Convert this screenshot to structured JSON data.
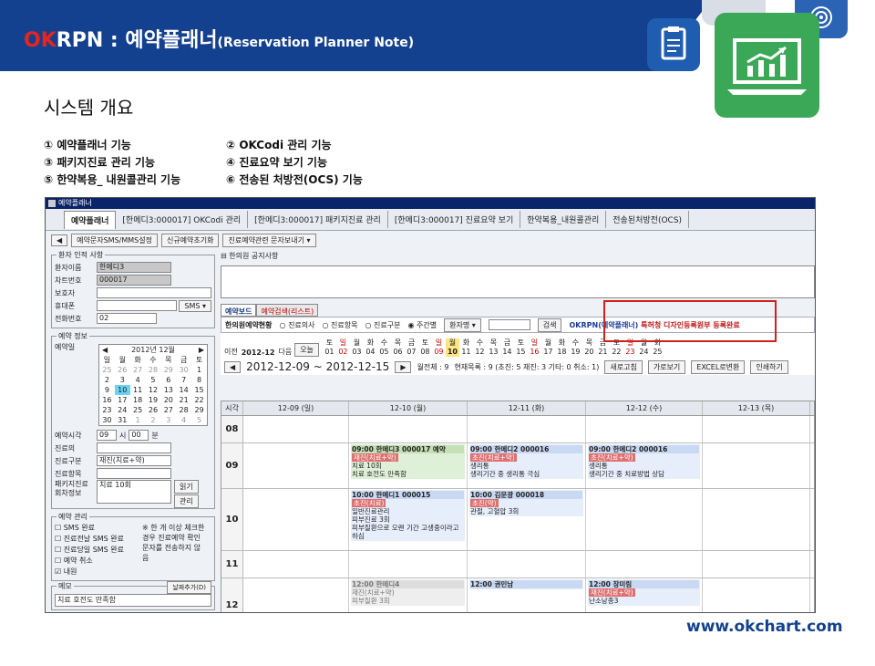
{
  "banner": {
    "title_ok": "OK",
    "title_rest": "RPN : 예약플래너",
    "title_sub": "(Reservation Planner Note)",
    "accent": "#e8241c",
    "brand": "#14418f"
  },
  "section_title": "시스템 개요",
  "features": [
    [
      "① 예약플래너 기능",
      "② OKCodi 관리 기능"
    ],
    [
      "③ 패키지진료 관리 기능",
      "④ 진료요약 보기 기능"
    ],
    [
      "⑤ 한약복용_ 내원콜관리 기능",
      "⑥ 전송된 처방전(OCS) 기능"
    ]
  ],
  "app": {
    "window_title": "예약플래너",
    "tabs": [
      "예약플래너",
      "[한메디3:000017] OKCodi 관리",
      "[한메디3:000017] 패키지진료 관리",
      "[한메디3:000017] 진료요약 보기",
      "한약복용_내원콜관리",
      "전송된처방전(OCS)"
    ],
    "toolbar": [
      "예약문자SMS/MMS설정",
      "신규예약초기화",
      "진료예약관련 문자보내기 ▾"
    ],
    "patient": {
      "legend": "환자 인적 사항",
      "fields": [
        {
          "label": "환자이름",
          "value": "한메디3"
        },
        {
          "label": "차트번호",
          "value": "000017"
        },
        {
          "label": "보호자",
          "value": ""
        },
        {
          "label": "휴대폰",
          "value": ""
        },
        {
          "label": "전화번호",
          "value": "02"
        }
      ],
      "sms_label": "SMS ▾"
    },
    "reservation": {
      "legend": "예약 정보",
      "date_label": "예약일",
      "cal_title": "2012년 12월",
      "weekdays": [
        "일",
        "월",
        "화",
        "수",
        "목",
        "금",
        "토"
      ],
      "weeks": [
        [
          "25",
          "26",
          "27",
          "28",
          "29",
          "30",
          "1"
        ],
        [
          "2",
          "3",
          "4",
          "5",
          "6",
          "7",
          "8"
        ],
        [
          "9",
          "10",
          "11",
          "12",
          "13",
          "14",
          "15"
        ],
        [
          "16",
          "17",
          "18",
          "19",
          "20",
          "21",
          "22"
        ],
        [
          "23",
          "24",
          "25",
          "26",
          "27",
          "28",
          "29"
        ],
        [
          "30",
          "31",
          "1",
          "2",
          "3",
          "4",
          "5"
        ]
      ],
      "time_label": "예약시각",
      "time_hour": "09",
      "time_min": "00",
      "hour_unit": "시",
      "min_unit": "분",
      "fields": [
        {
          "label": "진료의",
          "value": ""
        },
        {
          "label": "진료구분",
          "value": "재진(치료+약)"
        },
        {
          "label": "진료항목",
          "value": ""
        },
        {
          "label": "패키지진료",
          "value": "치료 10회"
        }
      ],
      "visit_label": "회차정보",
      "read_btn": "읽기",
      "manage_btn": "관리"
    },
    "manage": {
      "legend": "예약 관리",
      "checks": [
        "SMS 완료",
        "진료전날 SMS 완료",
        "진료당일 SMS 완료",
        "예약 취소",
        "내원"
      ],
      "note": "※ 한 개 이상 체크한 경우 진료예약 확인 문자를 전송하지 않음"
    },
    "memo": {
      "label": "메모",
      "add_btn": "날짜추가(D)",
      "text": "치료 호전도 만족함"
    },
    "notice_title": "한의원 공지사항",
    "board_tabs": [
      "예약보드",
      "예약검색(리스트)"
    ],
    "options": {
      "title": "한의원예약현황",
      "radios": [
        "진료의사",
        "진료항목",
        "진료구분",
        "주간별"
      ],
      "search_field": "환자명 ▾",
      "search_btn": "검색",
      "promo_prefix": "OKRPN(예약플래너)",
      "promo_text": "특허청 디자인등록원부 등록완료"
    },
    "dayrow": {
      "prev": "이전",
      "month": "2012-12",
      "next": "다음",
      "today": "오늘",
      "days": [
        [
          "토",
          "01"
        ],
        [
          "일",
          "02"
        ],
        [
          "월",
          "03"
        ],
        [
          "화",
          "04"
        ],
        [
          "수",
          "05"
        ],
        [
          "목",
          "06"
        ],
        [
          "금",
          "07"
        ],
        [
          "토",
          "08"
        ],
        [
          "일",
          "09"
        ],
        [
          "월",
          "10"
        ],
        [
          "화",
          "11"
        ],
        [
          "수",
          "12"
        ],
        [
          "목",
          "13"
        ],
        [
          "금",
          "14"
        ],
        [
          "토",
          "15"
        ],
        [
          "일",
          "16"
        ],
        [
          "월",
          "17"
        ],
        [
          "화",
          "18"
        ],
        [
          "수",
          "19"
        ],
        [
          "목",
          "20"
        ],
        [
          "금",
          "21"
        ],
        [
          "토",
          "22"
        ],
        [
          "일",
          "23"
        ],
        [
          "월",
          "24"
        ],
        [
          "화",
          "25"
        ]
      ]
    },
    "week": {
      "range": "2012-12-09 ~ 2012-12-15",
      "total": "월전체 : 9",
      "current": "현재목록 : 9 (초진: 5 재진: 3 기타: 0 취소: 1)",
      "buttons": [
        "새로고침",
        "가로보기",
        "EXCEL로변환",
        "인쇄하기"
      ]
    },
    "grid": {
      "time_header": "시각",
      "headers": [
        "12-09 (일)",
        "12-10 (월)",
        "12-11 (화)",
        "12-12 (수)",
        "12-13 (목)"
      ],
      "rows": [
        {
          "time": "08",
          "cells": [
            [],
            [],
            [],
            [],
            []
          ]
        },
        {
          "time": "09",
          "cells": [
            [],
            [
              {
                "style": "green",
                "name": "09:00 한메디3 000017 예약",
                "tag": "재진(치료+약)",
                "l1": "치료 10회",
                "l2": "치료 호전도 만족함"
              }
            ],
            [
              {
                "style": "blue",
                "name": "09:00 한메디2 000016",
                "tag": "초진(치료+약)",
                "l1": "생리통",
                "l2": "생리기간 중 생리통 극심"
              }
            ],
            [
              {
                "style": "blue",
                "name": "09:00 한메디2 000016",
                "tag": "초진(치료+약)",
                "l1": "생리통",
                "l2": "생리기간 중 치료방법 상담"
              }
            ],
            []
          ]
        },
        {
          "time": "10",
          "cells": [
            [],
            [
              {
                "style": "blue",
                "name": "10:00 한메디1 000015",
                "tag": "초진(치료)",
                "l1": "일반진료관리",
                "l2": "피부진료 3회",
                "l3": "피부질환으로 오랜 기간 고생중이라고 하심"
              }
            ],
            [
              {
                "style": "blue",
                "name": "10:00 김문광 000018",
                "tag": "초진(약)",
                "l1": "관절, 고혈압 3회",
                "l2": ""
              }
            ],
            [],
            []
          ]
        },
        {
          "time": "11",
          "cells": [
            [],
            [],
            [],
            [],
            []
          ]
        },
        {
          "time": "12",
          "cells": [
            [],
            [
              {
                "style": "gray",
                "name": "12:00 한메디4",
                "tag": "",
                "l1": "재진(치료+약)",
                "l2": "피부질환 3회"
              }
            ],
            [
              {
                "style": "blue",
                "name": "12:00 권민남",
                "tag": "",
                "l1": "",
                "l2": ""
              }
            ],
            [
              {
                "style": "blue",
                "name": "12:00 장미림",
                "tag": "재진(치료+약)",
                "l1": "난소낭종3",
                "l2": ""
              }
            ],
            []
          ]
        }
      ]
    }
  },
  "url": "www.okchart.com"
}
